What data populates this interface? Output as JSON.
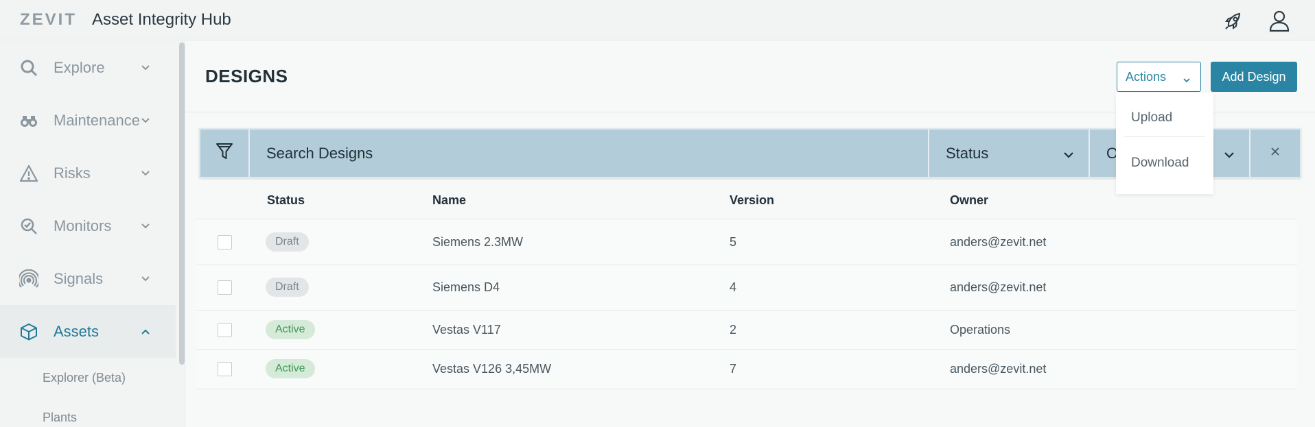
{
  "topbar": {
    "logo": "ZEVIT",
    "title": "Asset Integrity Hub",
    "icons": [
      "rocket-icon",
      "user-icon"
    ]
  },
  "sidebar": {
    "items": [
      {
        "label": "Explore",
        "icon": "search-icon",
        "expanded": false
      },
      {
        "label": "Maintenance",
        "icon": "binoculars-icon",
        "expanded": false
      },
      {
        "label": "Risks",
        "icon": "warning-icon",
        "expanded": false
      },
      {
        "label": "Monitors",
        "icon": "monitor-search-icon",
        "expanded": false
      },
      {
        "label": "Signals",
        "icon": "signal-icon",
        "expanded": false
      },
      {
        "label": "Assets",
        "icon": "cube-icon",
        "expanded": true,
        "active": true
      }
    ],
    "subitems": [
      "Explorer (Beta)",
      "Plants"
    ]
  },
  "page": {
    "title": "DESIGNS",
    "actions_label": "Actions",
    "add_label": "Add Design"
  },
  "actions_menu": {
    "items": [
      "Upload",
      "Download"
    ]
  },
  "filter": {
    "search_placeholder": "Search Designs",
    "status_label": "Status",
    "owner_label_partial": "O"
  },
  "table": {
    "headers": [
      "Status",
      "Name",
      "Version",
      "Owner"
    ],
    "rows": [
      {
        "status": "Draft",
        "name": "Siemens 2.3MW",
        "version": "5",
        "owner": "anders@zevit.net"
      },
      {
        "status": "Draft",
        "name": "Siemens D4",
        "version": "4",
        "owner": "anders@zevit.net"
      },
      {
        "status": "Active",
        "name": "Vestas V117",
        "version": "2",
        "owner": "Operations"
      },
      {
        "status": "Active",
        "name": "Vestas V126 3,45MW",
        "version": "7",
        "owner": "anders@zevit.net"
      }
    ]
  },
  "colors": {
    "accent": "#2a85a5",
    "filter_bg": "#b2cdd9",
    "draft_bg": "#e3e6e8",
    "active_bg": "#d5ead9",
    "active_text": "#3b9a55"
  }
}
